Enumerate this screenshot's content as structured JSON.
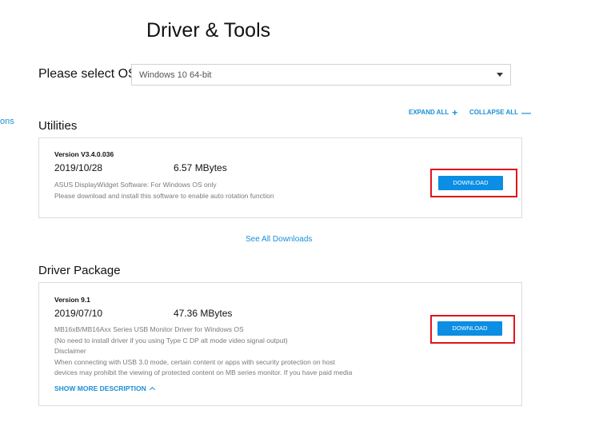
{
  "page": {
    "title": "Driver & Tools"
  },
  "os": {
    "label": "Please select OS",
    "selected": "Windows 10 64-bit"
  },
  "left_partial": {
    "text": "ons"
  },
  "controls": {
    "expand_all": "EXPAND ALL",
    "collapse_all": "COLLAPSE ALL"
  },
  "sections": {
    "utilities": {
      "title": "Utilities",
      "item": {
        "version": "Version V3.4.0.036",
        "date": "2019/10/28",
        "size": "6.57 MBytes",
        "desc": [
          "ASUS DisplayWidget Software: For Windows OS only",
          "Please download and install this software to enable auto rotation function"
        ],
        "download": "DOWNLOAD"
      },
      "see_all": "See All Downloads"
    },
    "driver": {
      "title": "Driver Package",
      "item": {
        "version": "Version 9.1",
        "date": "2019/07/10",
        "size": "47.36 MBytes",
        "desc": [
          "MB16xB/MB16Axx Series USB Monitor Driver for Windows OS",
          "(No need to install driver if you using Type C DP alt mode video signal output)",
          "Disclaimer",
          "When connecting with USB 3.0 mode, certain content or apps with security protection on host",
          "devices may prohibit the viewing of protected content on MB series monitor. If you have paid media"
        ],
        "download": "DOWNLOAD",
        "show_more": "SHOW MORE DESCRIPTION"
      }
    }
  },
  "colors": {
    "accent": "#0b8ee3",
    "link": "#1a8fd6",
    "highlight": "#e0141e"
  }
}
